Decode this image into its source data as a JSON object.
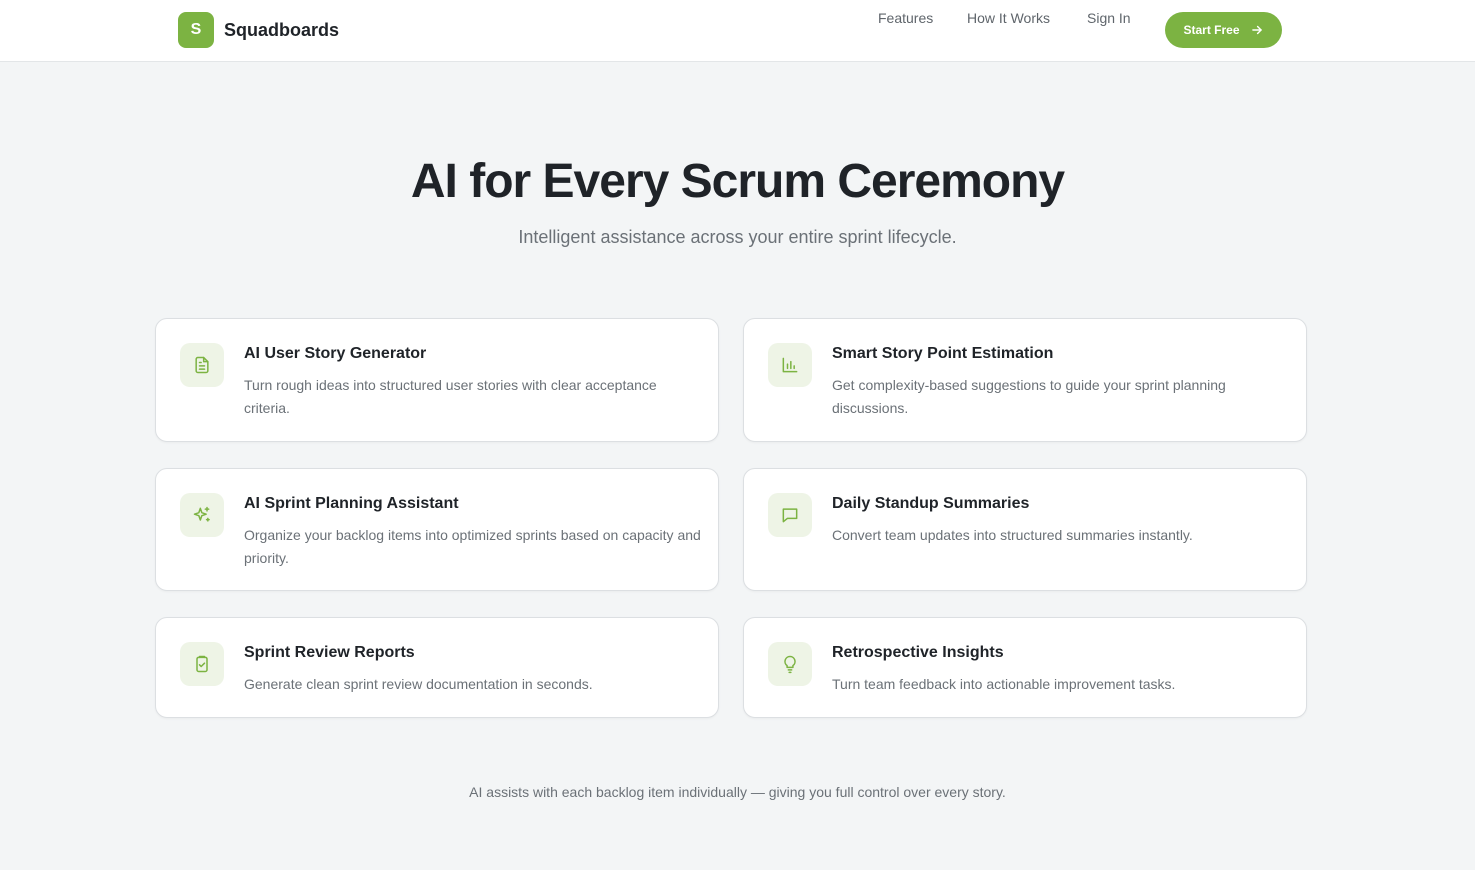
{
  "brand": {
    "logo_letter": "S",
    "name": "Squadboards",
    "color": "#7cb342"
  },
  "nav": {
    "features": "Features",
    "how_it_works": "How It Works",
    "sign_in": "Sign In",
    "cta": "Start Free",
    "cta_icon": "arrow-right-icon"
  },
  "hero": {
    "title": "AI for Every Scrum Ceremony",
    "subtitle": "Intelligent assistance across your entire sprint lifecycle."
  },
  "features": [
    {
      "title": "AI User Story Generator",
      "description": "Turn rough ideas into structured user stories with clear acceptance criteria.",
      "icon": "document-icon"
    },
    {
      "title": "Smart Story Point Estimation",
      "description": "Get complexity-based suggestions to guide your sprint planning discussions.",
      "icon": "bar-chart-icon"
    },
    {
      "title": "AI Sprint Planning Assistant",
      "description": "Organize your backlog items into optimized sprints based on capacity and priority.",
      "icon": "sparkles-icon"
    },
    {
      "title": "Daily Standup Summaries",
      "description": "Convert team updates into structured summaries instantly.",
      "icon": "message-icon"
    },
    {
      "title": "Sprint Review Reports",
      "description": "Generate clean sprint review documentation in seconds.",
      "icon": "clipboard-check-icon"
    },
    {
      "title": "Retrospective Insights",
      "description": "Turn team feedback into actionable improvement tasks.",
      "icon": "lightbulb-icon"
    }
  ],
  "footnote": "AI assists with each backlog item individually — giving you full control over every story."
}
